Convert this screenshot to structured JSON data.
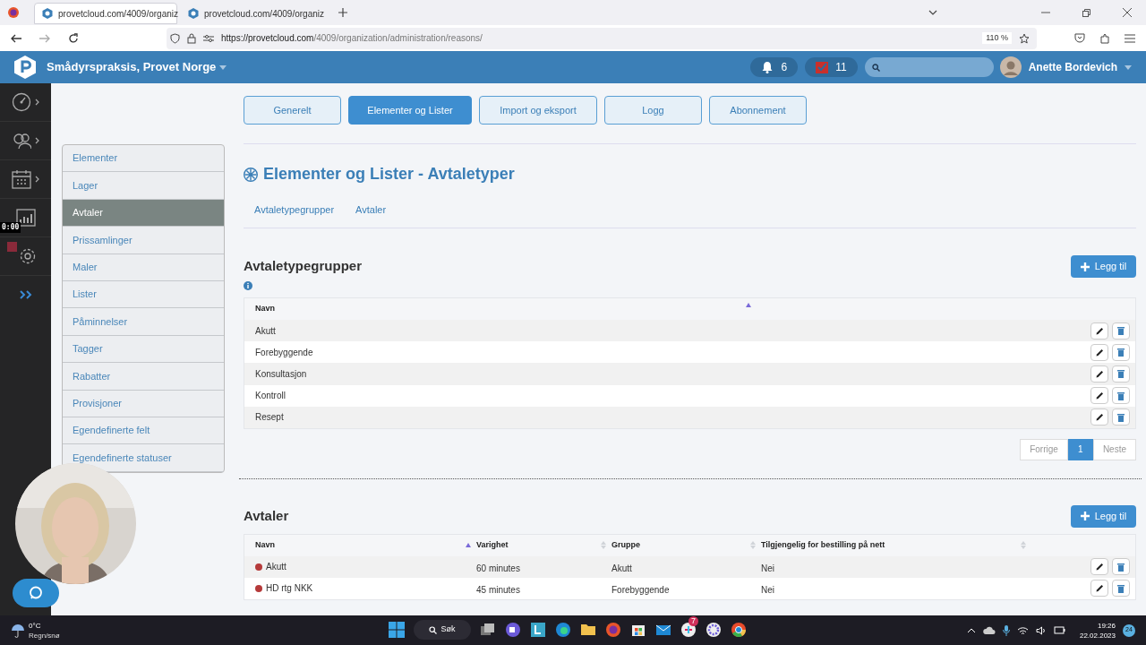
{
  "browser": {
    "tabs": [
      {
        "title": "provetcloud.com/4009/organiz",
        "selected": true
      },
      {
        "title": "provetcloud.com/4009/organiz",
        "selected": false
      }
    ],
    "url_host": "https://provetcloud.com",
    "url_path": "/4009/organization/administration/reasons/",
    "zoom": "110 %"
  },
  "header": {
    "clinic": "Smådyrspraksis, Provet Norge",
    "notifications": "6",
    "tasks": "11",
    "user": "Anette Bordevich"
  },
  "recording": {
    "time": "0:00"
  },
  "top_tabs": [
    {
      "label": "Generelt",
      "selected": false
    },
    {
      "label": "Elementer og Lister",
      "selected": true
    },
    {
      "label": "Import og eksport",
      "selected": false
    },
    {
      "label": "Logg",
      "selected": false
    },
    {
      "label": "Abonnement",
      "selected": false
    }
  ],
  "side_menu": [
    {
      "label": "Elementer",
      "selected": false
    },
    {
      "label": "Lager",
      "selected": false
    },
    {
      "label": "Avtaler",
      "selected": true
    },
    {
      "label": "Prissamlinger",
      "selected": false
    },
    {
      "label": "Maler",
      "selected": false
    },
    {
      "label": "Lister",
      "selected": false
    },
    {
      "label": "Påminnelser",
      "selected": false
    },
    {
      "label": "Tagger",
      "selected": false
    },
    {
      "label": "Rabatter",
      "selected": false
    },
    {
      "label": "Provisjoner",
      "selected": false
    },
    {
      "label": "Egendefinerte felt",
      "selected": false
    },
    {
      "label": "Egendefinerte statuser",
      "selected": false
    }
  ],
  "page_title": "Elementer og Lister - Avtaletyper",
  "sub_tabs": [
    "Avtaletypegrupper",
    "Avtaler"
  ],
  "groups": {
    "title": "Avtaletypegrupper",
    "add_button": "Legg til",
    "columns": [
      "Navn"
    ],
    "rows": [
      "Akutt",
      "Forebyggende",
      "Konsultasjon",
      "Kontroll",
      "Resept"
    ],
    "pagination": {
      "prev": "Forrige",
      "page": "1",
      "next": "Neste"
    }
  },
  "appointments": {
    "title": "Avtaler",
    "add_button": "Legg til",
    "columns": [
      "Navn",
      "Varighet",
      "Gruppe",
      "Tilgjengelig for bestilling på nett"
    ],
    "rows": [
      {
        "color": "#b53a3a",
        "name": "Akutt",
        "duration": "60 minutes",
        "group": "Akutt",
        "online": "Nei"
      },
      {
        "color": "#b53a3a",
        "name": "HD rtg NKK",
        "duration": "45 minutes",
        "group": "Forebyggende",
        "online": "Nei"
      }
    ]
  },
  "taskbar": {
    "temp": "0°C",
    "weather": "Regn/snø",
    "search": "Søk",
    "badge": "7",
    "time": "19:26",
    "date": "22.02.2023",
    "notif": "24"
  }
}
